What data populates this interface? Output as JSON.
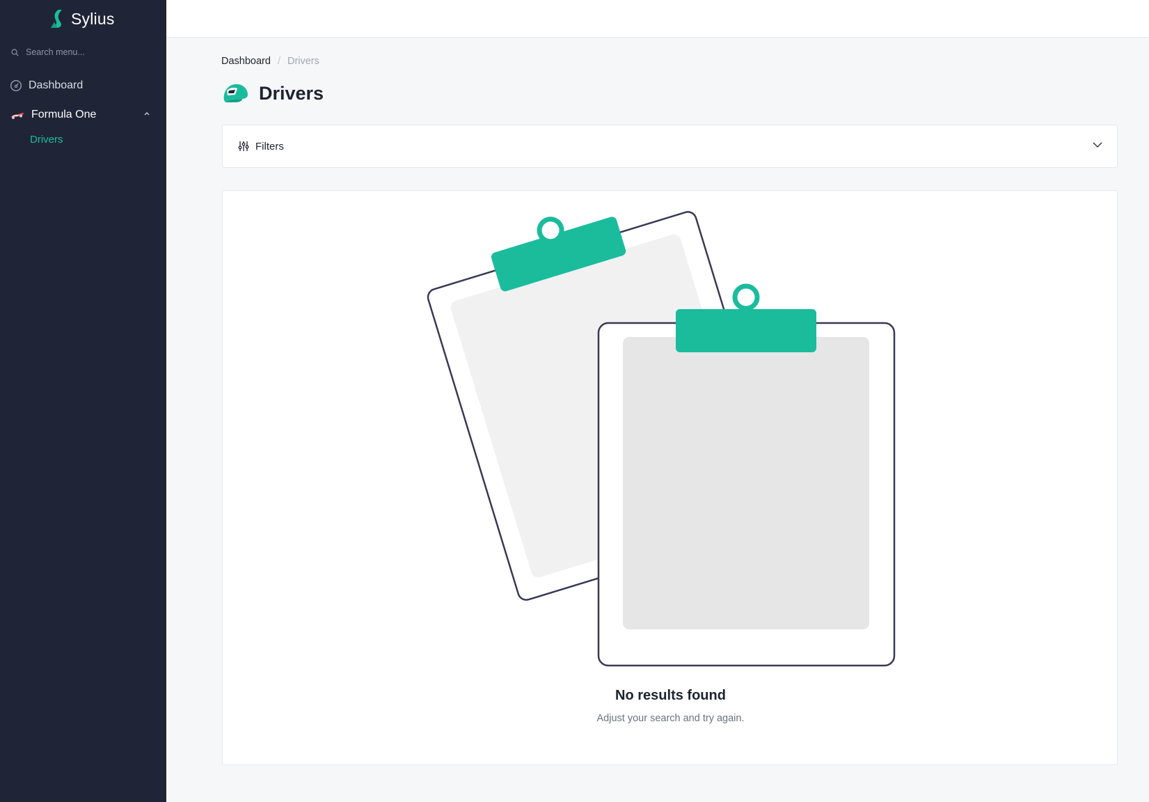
{
  "app": {
    "name": "Sylius"
  },
  "sidebar": {
    "search_placeholder": "Search menu...",
    "items": [
      {
        "label": "Dashboard",
        "icon": "dashboard-gauge-icon"
      },
      {
        "label": "Formula One",
        "icon": "race-car-icon",
        "expanded": true,
        "children": [
          {
            "label": "Drivers",
            "active": true
          }
        ]
      }
    ]
  },
  "breadcrumb": {
    "home": "Dashboard",
    "separator": "/",
    "current": "Drivers"
  },
  "page": {
    "title": "Drivers",
    "icon": "helmet-icon"
  },
  "filters": {
    "label": "Filters",
    "icon": "sliders-icon",
    "expanded": false
  },
  "empty_state": {
    "title": "No results found",
    "subtitle": "Adjust your search and try again.",
    "illustration": "clipboards-icon"
  },
  "colors": {
    "sidebar_bg": "#1f2536",
    "accent": "#1abc9c",
    "page_bg": "#f6f7f9"
  }
}
